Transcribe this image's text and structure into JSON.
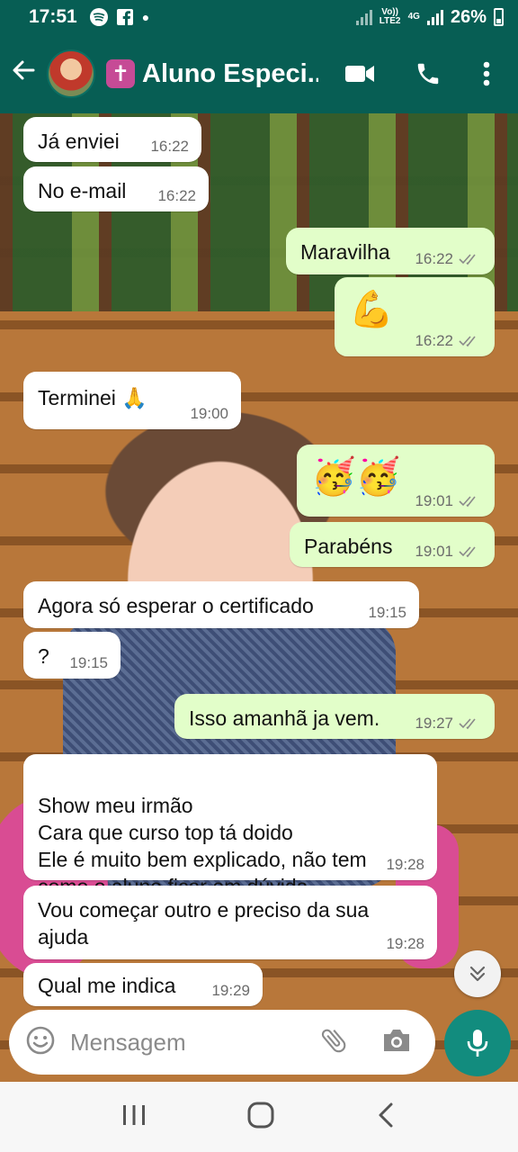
{
  "status_bar": {
    "time": "17:51",
    "network": "4G",
    "volte": "Vo)) LTE2",
    "battery": "26%"
  },
  "app_bar": {
    "contact_name": "Aluno Especi...",
    "icons": [
      "back-arrow-icon",
      "video-call-icon",
      "voice-call-icon",
      "more-vert-icon"
    ]
  },
  "messages": [
    {
      "direction": "in",
      "text": "Já enviei",
      "time": "16:22"
    },
    {
      "direction": "in",
      "text": "No e-mail",
      "time": "16:22"
    },
    {
      "direction": "out",
      "text": "Maravilha",
      "time": "16:22"
    },
    {
      "direction": "out",
      "text": "💪",
      "time": "16:22"
    },
    {
      "direction": "in",
      "text": "Terminei 🙏",
      "time": "19:00"
    },
    {
      "direction": "out",
      "text": "🥳🥳",
      "time": "19:01"
    },
    {
      "direction": "out",
      "text": "Parabéns",
      "time": "19:01"
    },
    {
      "direction": "in",
      "text": "Agora só esperar o certificado",
      "time": "19:15"
    },
    {
      "direction": "in",
      "text": "?",
      "time": "19:15"
    },
    {
      "direction": "out",
      "text": "Isso amanhã ja vem.",
      "time": "19:27"
    },
    {
      "direction": "in",
      "text": "Show meu irmão\nCara que curso top tá doido\nEle é muito bem explicado, não tem como o aluno ficar em dúvida",
      "time": "19:28"
    },
    {
      "direction": "in",
      "text": "Vou começar outro e preciso da sua ajuda",
      "time": "19:28"
    },
    {
      "direction": "in",
      "text": "Qual me indica",
      "time": "19:29"
    }
  ],
  "input": {
    "placeholder": "Mensagem"
  },
  "colors": {
    "header": "#075e54",
    "incoming_bubble": "#ffffff",
    "outgoing_bubble": "#e2fec9",
    "mic_button": "#128c7e",
    "read_ticks": "#8a8a8a"
  }
}
